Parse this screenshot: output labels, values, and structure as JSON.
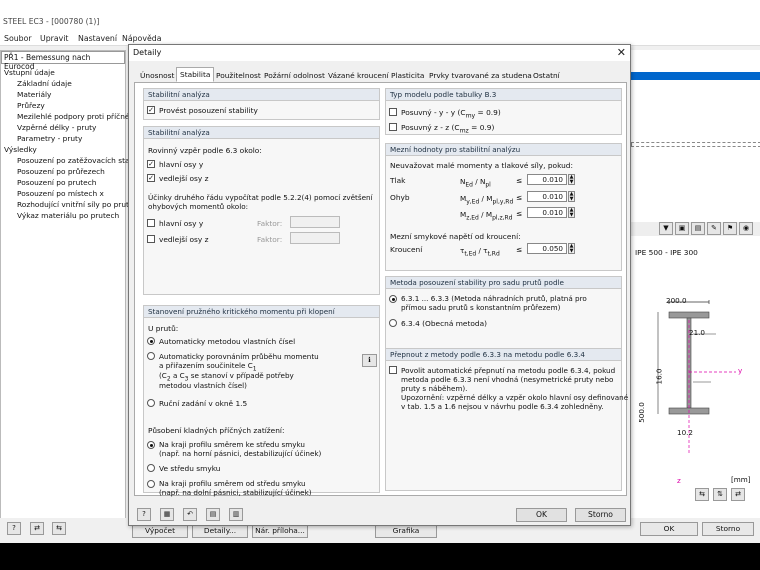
{
  "app": {
    "title": "STEEL EC3 - [000780 (1)]",
    "menu": [
      "Soubor",
      "Upravit",
      "Nastavení",
      "Nápověda"
    ]
  },
  "nav": {
    "case": "PŘ1 - Bemessung nach Eurocod",
    "items": [
      "Vstupní údaje",
      "Základní údaje",
      "Materiály",
      "Průřezy",
      "Mezilehlé podpory proti příčném",
      "Vzpěrné délky - pruty",
      "Parametry - pruty",
      "Výsledky",
      "Posouzení po zatěžovacích stav",
      "Posouzení po průřezech",
      "Posouzení po prutech",
      "Posouzení po místech x",
      "Rozhodující vnitřní síly po prute",
      "Výkaz materiálu po prutech"
    ]
  },
  "bottom": {
    "buttons": [
      "Výpočet",
      "Detaily...",
      "Nár. příloha...",
      "Grafika",
      "OK",
      "Storno"
    ]
  },
  "right": {
    "section_label": "IPE 500 - IPE 300",
    "dims": [
      "200.0",
      "21.0",
      "16.0",
      "500.0",
      "10.2"
    ],
    "axis_y": "y",
    "axis_z": "z",
    "unit": "[mm]"
  },
  "dialog": {
    "title": "Detaily",
    "tabs": [
      "Únosnost",
      "Stabilita",
      "Použitelnost",
      "Požární odolnost",
      "Vázané kroucení",
      "Plasticita",
      "Prvky tvarované za studena",
      "Ostatní"
    ],
    "g1": {
      "title": "Stabilitní analýza",
      "check": "Provést posouzení stability"
    },
    "g2": {
      "title": "Stabilitní analýza",
      "plane_label": "Rovinný vzpěr podle 6.3 okolo:",
      "main_axis": "hlavní osy y",
      "minor_axis": "vedlejší osy z",
      "second_order": "Účinky druhého řádu vypočítat podle 5.2.2(4) pomocí zvětšení ohybových momentů okolo:",
      "main_axis2": "hlavní osy y",
      "minor_axis2": "vedlejší osy z",
      "factor": "Faktor:"
    },
    "g3": {
      "title": "Stanovení pružného kritického momentu při klopení",
      "intro": "U prutů:",
      "opt1": "Automaticky metodou vlastních čísel",
      "opt2a": "Automaticky porovnáním průběhu momentu",
      "opt2b": "a přiřazením součinitele C",
      "opt2c": "(C",
      "opt2d": " a C",
      "opt2e": " se stanoví v případě potřeby",
      "opt2f": "metodou vlastních čísel)",
      "opt3": "Ruční zadání v okně 1.5",
      "load_label": "Působení kladných příčných zatížení:",
      "l1a": "Na kraji profilu směrem ke středu smyku",
      "l1b": "(např. na horní pásnici, destabilizující účinek)",
      "l2": "Ve středu smyku",
      "l3a": "Na kraji profilu směrem od středu smyku",
      "l3b": "(např. na dolní pásnici, stabilizující účinek)"
    },
    "g4": {
      "title": "Typ modelu podle tabulky B.3",
      "o1": "Posuvný - y - y (C",
      "o1b": " = 0.9)",
      "o2": "Posuvný z - z (C",
      "o2b": " = 0.9)",
      "sub1": "my",
      "sub2": "mz"
    },
    "g5": {
      "title": "Mezní hodnoty pro stabilitní analýzu",
      "desc": "Neuvažovat malé momenty a tlakové síly, pokud:",
      "r1": "Tlak",
      "r1f": "N",
      "r1v": "0.010",
      "r2": "Ohyb",
      "r2v": "0.010",
      "r3v": "0.010",
      "shear": "Mezní smykové napětí od kroucení:",
      "r4": "Kroucení",
      "r4v": "0.050",
      "le": "≤"
    },
    "g6": {
      "title": "Metoda posouzení stability pro sadu prutů podle",
      "o1a": "6.3.1 ... 6.3.3 (Metoda náhradních prutů, platná pro",
      "o1b": "přímou sadu prutů s konstantním průřezem)",
      "o2": "6.3.4 (Obecná metoda)"
    },
    "g7": {
      "title": "Přepnout z metody podle 6.3.3 na metodu podle 6.3.4",
      "t1": "Povolit automatické přepnutí na metodu podle 6.3.4, pokud",
      "t2": "metoda podle 6.3.3 není vhodná (nesymetrické pruty nebo",
      "t3": "pruty s náběhem).",
      "t4": "Upozornění: vzpěrné délky a vzpěr okolo hlavní osy definované",
      "t5": "v tab. 1.5 a 1.6 nejsou v návrhu podle 6.3.4 zohledněny."
    },
    "buttons": {
      "ok": "OK",
      "cancel": "Storno"
    }
  },
  "colors": {
    "group_header": "#e4e9f0",
    "accent": "#0066cc"
  }
}
